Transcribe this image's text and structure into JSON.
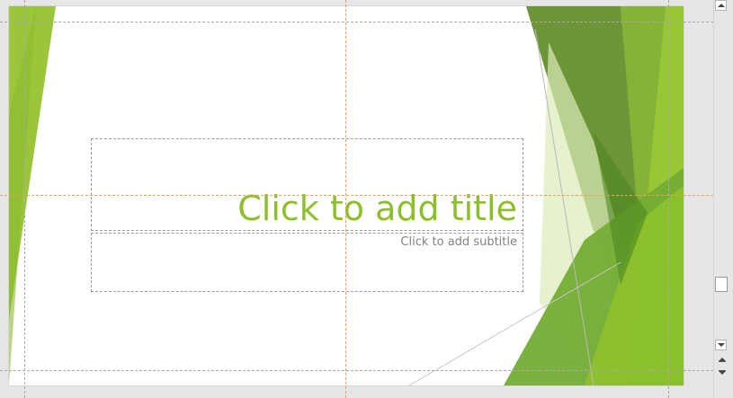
{
  "slide": {
    "title_placeholder": "Click to add title",
    "subtitle_placeholder": "Click to add subtitle"
  },
  "colors": {
    "title_text": "#8dbf2a",
    "subtitle_text": "#808080",
    "accent_green_light": "#a4c93b",
    "accent_green_dark": "#5f8c2a",
    "guide_center": "#f0a050",
    "guide_default": "#a8a8a8"
  },
  "scrollbar": {
    "up_icon": "triangle-up",
    "down_icon": "triangle-down",
    "previous_slide_icon": "double-arrow-up",
    "next_slide_icon": "double-arrow-down"
  }
}
